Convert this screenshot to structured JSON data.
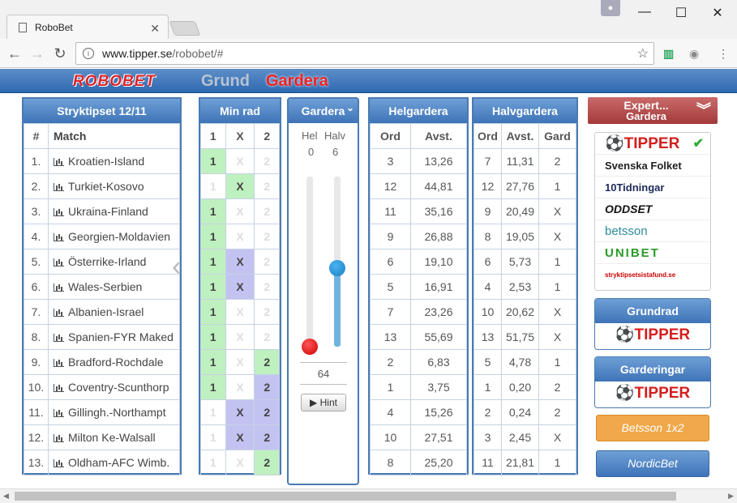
{
  "browser": {
    "tab_title": "RoboBet",
    "url_host": "www.tipper.se",
    "url_path": "/robobet/#"
  },
  "header": {
    "logo": "ROBOBET",
    "nav_grund": "Grund",
    "nav_gardera": "Gardera"
  },
  "stryktips": {
    "title": "Stryktipset 12/11",
    "col_num": "#",
    "col_match": "Match",
    "rows": [
      {
        "n": "1.",
        "match": "Kroatien-Island"
      },
      {
        "n": "2.",
        "match": "Turkiet-Kosovo"
      },
      {
        "n": "3.",
        "match": "Ukraina-Finland"
      },
      {
        "n": "4.",
        "match": "Georgien-Moldavien"
      },
      {
        "n": "5.",
        "match": "Österrike-Irland"
      },
      {
        "n": "6.",
        "match": "Wales-Serbien"
      },
      {
        "n": "7.",
        "match": "Albanien-Israel"
      },
      {
        "n": "8.",
        "match": "Spanien-FYR Maked"
      },
      {
        "n": "9.",
        "match": "Bradford-Rochdale"
      },
      {
        "n": "10.",
        "match": "Coventry-Scunthorp"
      },
      {
        "n": "11.",
        "match": "Gillingh.-Northampt"
      },
      {
        "n": "12.",
        "match": "Milton Ke-Walsall"
      },
      {
        "n": "13.",
        "match": "Oldham-AFC Wimb."
      }
    ]
  },
  "minrad": {
    "title": "Min rad",
    "cols": [
      "1",
      "X",
      "2"
    ],
    "rows": [
      [
        "1",
        "X",
        "2"
      ],
      [
        "1",
        "X",
        "2"
      ],
      [
        "1",
        "X",
        "2"
      ],
      [
        "1",
        "X",
        "2"
      ],
      [
        "1",
        "X",
        "2"
      ],
      [
        "1",
        "X",
        "2"
      ],
      [
        "1",
        "X",
        "2"
      ],
      [
        "1",
        "X",
        "2"
      ],
      [
        "1",
        "X",
        "2"
      ],
      [
        "1",
        "X",
        "2"
      ],
      [
        "1",
        "X",
        "2"
      ],
      [
        "1",
        "X",
        "2"
      ],
      [
        "1",
        "X",
        "2"
      ]
    ]
  },
  "gardera": {
    "title": "Gardera",
    "hel_label": "Hel",
    "halv_label": "Halv",
    "hel_value": "0",
    "halv_value": "6",
    "rows_count": "64",
    "hint_label": "Hint",
    "hel_level": 0.0,
    "halv_level": 0.46
  },
  "helgardera": {
    "title": "Helgardera",
    "cols": [
      "Ord",
      "Avst."
    ],
    "rows": [
      [
        "3",
        "13,26"
      ],
      [
        "12",
        "44,81"
      ],
      [
        "11",
        "35,16"
      ],
      [
        "9",
        "26,88"
      ],
      [
        "6",
        "19,10"
      ],
      [
        "5",
        "16,91"
      ],
      [
        "7",
        "23,26"
      ],
      [
        "13",
        "55,69"
      ],
      [
        "2",
        "6,83"
      ],
      [
        "1",
        "3,75"
      ],
      [
        "4",
        "15,26"
      ],
      [
        "10",
        "27,51"
      ],
      [
        "8",
        "25,20"
      ]
    ]
  },
  "halvgardera": {
    "title": "Halvgardera",
    "cols": [
      "Ord",
      "Avst.",
      "Gard"
    ],
    "rows": [
      [
        "7",
        "11,31",
        "2"
      ],
      [
        "12",
        "27,76",
        "1"
      ],
      [
        "9",
        "20,49",
        "X"
      ],
      [
        "8",
        "19,05",
        "X"
      ],
      [
        "6",
        "5,73",
        "1"
      ],
      [
        "4",
        "2,53",
        "1"
      ],
      [
        "10",
        "20,62",
        "X"
      ],
      [
        "13",
        "51,75",
        "X"
      ],
      [
        "5",
        "4,78",
        "1"
      ],
      [
        "1",
        "0,20",
        "2"
      ],
      [
        "2",
        "0,24",
        "2"
      ],
      [
        "3",
        "2,45",
        "X"
      ],
      [
        "11",
        "21,81",
        "1"
      ]
    ]
  },
  "expert": {
    "title": "Expert...",
    "subtitle": "Gardera",
    "sources": [
      "TIPPER",
      "Svenska Folket",
      "10Tidningar",
      "ODDSET",
      "betsson",
      "UNIBET",
      "stryktipsetsistafund.se"
    ],
    "check": "✔"
  },
  "grundrad": {
    "title": "Grundrad",
    "logo": "TIPPER"
  },
  "garderingar": {
    "title": "Garderingar",
    "logo": "TIPPER"
  },
  "betsson_btn": "Betsson 1x2",
  "nordicbet_btn": "NordicBet",
  "colors": {
    "header": "#3e74b8",
    "sel_one": "#bff0bf",
    "sel_x": "#c3c3f2",
    "expert_header": "#b94b4b",
    "betsson": "#f0a84a",
    "nordic": "#5b8cc4"
  }
}
